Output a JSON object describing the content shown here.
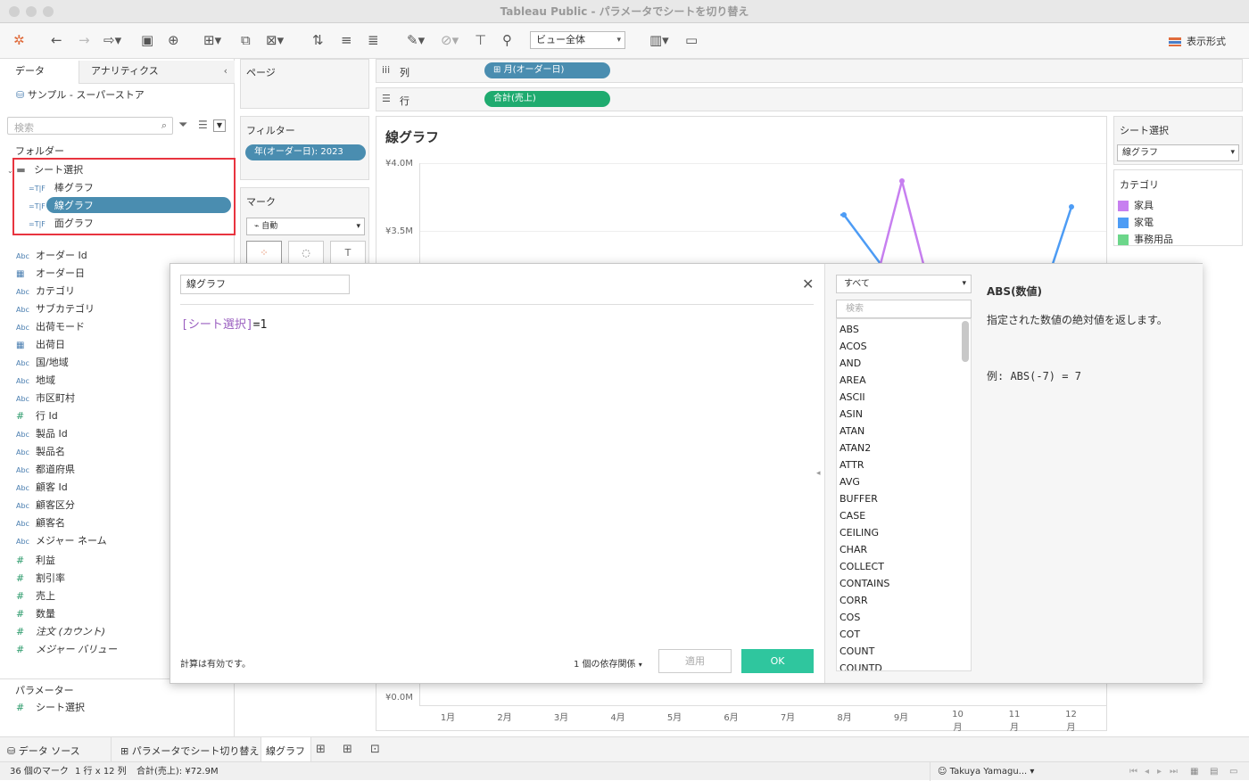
{
  "window": {
    "title": "Tableau Public - パラメータでシートを切り替え"
  },
  "toolbar": {
    "view_select": "ビュー全体",
    "show_me": "表示形式"
  },
  "left": {
    "tabs": [
      "データ",
      "アナリティクス"
    ],
    "datasource": "サンプル - スーパーストア",
    "search_placeholder": "検索",
    "folder_header": "フォルダー",
    "folder": {
      "name": "シート選択",
      "items": [
        "棒グラフ",
        "線グラフ",
        "面グラフ"
      ]
    },
    "dimensions": [
      {
        "type": "Abc",
        "name": "オーダー Id"
      },
      {
        "type": "date",
        "name": "オーダー日"
      },
      {
        "type": "Abc",
        "name": "カテゴリ"
      },
      {
        "type": "Abc",
        "name": "サブカテゴリ"
      },
      {
        "type": "Abc",
        "name": "出荷モード"
      },
      {
        "type": "date",
        "name": "出荷日"
      },
      {
        "type": "Abc",
        "name": "国/地域"
      },
      {
        "type": "Abc",
        "name": "地域"
      },
      {
        "type": "Abc",
        "name": "市区町村"
      },
      {
        "type": "#",
        "name": "行 Id"
      },
      {
        "type": "Abc",
        "name": "製品 Id"
      },
      {
        "type": "Abc",
        "name": "製品名"
      },
      {
        "type": "Abc",
        "name": "都道府県"
      },
      {
        "type": "Abc",
        "name": "顧客 Id"
      },
      {
        "type": "Abc",
        "name": "顧客区分"
      },
      {
        "type": "Abc",
        "name": "顧客名"
      },
      {
        "type": "Abc",
        "name": "メジャー ネーム"
      }
    ],
    "measures": [
      "利益",
      "割引率",
      "売上",
      "数量",
      "注文 (カウント)",
      "メジャー バリュー"
    ],
    "param_header": "パラメーター",
    "parameter": "シート選択"
  },
  "cards": {
    "pages": "ページ",
    "filters": "フィルター",
    "filter_pill": "年(オーダー日): 2023",
    "marks": "マーク",
    "mark_type": "自動"
  },
  "shelves": {
    "columns_label": "列",
    "columns_pill": "月(オーダー日)",
    "rows_label": "行",
    "rows_pill": "合計(売上)"
  },
  "view": {
    "title": "線グラフ"
  },
  "chart_data": {
    "type": "line",
    "x": [
      "1月",
      "2月",
      "3月",
      "4月",
      "5月",
      "6月",
      "7月",
      "8月",
      "9月",
      "10月",
      "11月",
      "12月"
    ],
    "y_ticks": [
      "¥4.0M",
      "¥3.5M",
      "¥0.0M"
    ],
    "visible_points": [
      {
        "series": "家電",
        "x": "8月",
        "y": 3.6
      },
      {
        "series": "家具",
        "x": "9月",
        "y": 3.85
      },
      {
        "series": "家電",
        "x": "12月",
        "y": 3.67
      }
    ]
  },
  "right": {
    "param_title": "シート選択",
    "param_value": "線グラフ",
    "legend_title": "カテゴリ",
    "legend": [
      {
        "name": "家具",
        "color": "#c77ff0"
      },
      {
        "name": "家電",
        "color": "#4d9cf5"
      },
      {
        "name": "事務用品",
        "color": "#6cd68a"
      }
    ]
  },
  "calc": {
    "name": "線グラフ",
    "formula_field": "[シート選択]",
    "formula_rest": "=1",
    "status": "計算は有効です。",
    "deps": "1 個の依存関係",
    "apply": "適用",
    "ok": "OK",
    "fn_filter": "すべて",
    "fn_search": "検索",
    "functions": [
      "ABS",
      "ACOS",
      "AND",
      "AREA",
      "ASCII",
      "ASIN",
      "ATAN",
      "ATAN2",
      "ATTR",
      "AVG",
      "BUFFER",
      "CASE",
      "CEILING",
      "CHAR",
      "COLLECT",
      "CONTAINS",
      "CORR",
      "COS",
      "COT",
      "COUNT",
      "COUNTD"
    ],
    "help_title": "ABS(数値)",
    "help_text": "指定された数値の絶対値を返します。",
    "help_example": "例: ABS(-7) = 7"
  },
  "sheets": {
    "datasource": "データ ソース",
    "dashboard": "パラメータでシート切り替え",
    "current": "線グラフ"
  },
  "status": {
    "marks": "36 個のマーク",
    "dims": "1 行 x 12 列",
    "sum": "合計(売上): ¥72.9M",
    "user": "Takuya Yamagu..."
  }
}
